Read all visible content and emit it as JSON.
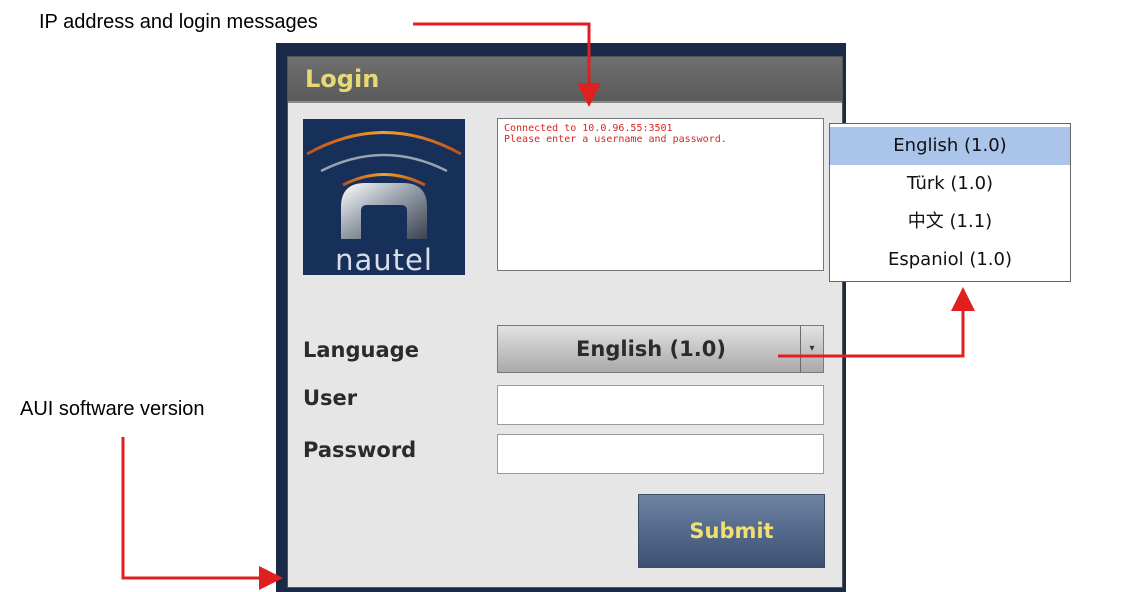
{
  "callouts": {
    "ip": "IP address and login messages",
    "aui": "AUI software version"
  },
  "window": {
    "title": "Login",
    "logo_text": "nautel",
    "messages": [
      "Connected to 10.0.96.55:3501",
      "Please enter a username and password."
    ],
    "message_color": "#d9251d",
    "language_label": "Language",
    "language_selected": "English (1.0)",
    "user_label": "User",
    "user_value": "",
    "password_label": "Password",
    "password_value": "",
    "submit_label": "Submit"
  },
  "language_options": [
    "English (1.0)",
    "Türk (1.0)",
    "中文 (1.1)",
    "Espaniol (1.0)"
  ],
  "selected_option_index": 0,
  "colors": {
    "accent_text": "#e8d977",
    "arrow": "#e02020",
    "selection": "#aac4ea"
  },
  "icons": {
    "dropdown": "chevron-down-icon",
    "logo": "nautel-logo"
  }
}
